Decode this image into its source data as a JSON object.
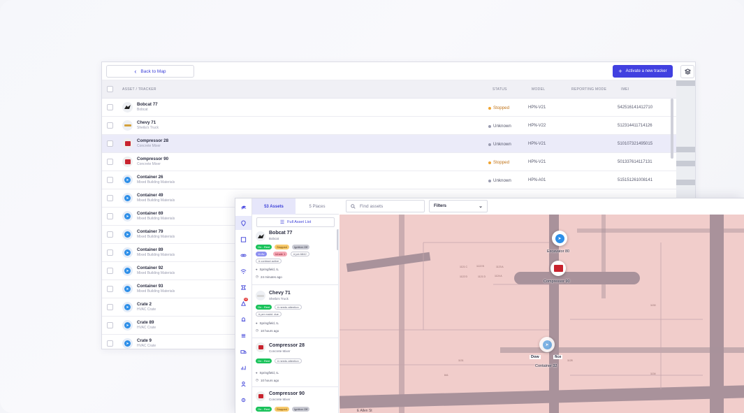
{
  "table_window": {
    "back_label": "Back to Map",
    "activate_label": "Activate a new tracker",
    "columns": {
      "asset": "ASSET / TRACKER",
      "status": "STATUS",
      "model": "MODEL",
      "reporting": "REPORTING MODE",
      "imei": "IMEI"
    },
    "rows": [
      {
        "name": "Bobcat 77",
        "sub": "Bobcat",
        "status": "Stopped",
        "model": "HPN-V21",
        "imei": "542516141412710"
      },
      {
        "name": "Chevy 71",
        "sub": "Sheila's Truck",
        "status": "Unknown",
        "model": "HPN-V22",
        "imei": "512314411714126"
      },
      {
        "name": "Compressor 28",
        "sub": "Concrete Mixer",
        "status": "Unknown",
        "model": "HPN-V21",
        "imei": "510107321495015"
      },
      {
        "name": "Compressor 90",
        "sub": "Concrete Mixer",
        "status": "Stopped",
        "model": "HPN-V21",
        "imei": "501337614117131"
      },
      {
        "name": "Container 26",
        "sub": "Mixed Building Materials",
        "status": "Unknown",
        "model": "HPN-A01",
        "imei": "515151261008141"
      },
      {
        "name": "Container 49",
        "sub": "Mixed Building Materials"
      },
      {
        "name": "Container 69",
        "sub": "Mixed Building Materials"
      },
      {
        "name": "Container 79",
        "sub": "Mixed Building Materials"
      },
      {
        "name": "Container 89",
        "sub": "Mixed Building Materials"
      },
      {
        "name": "Container 92",
        "sub": "Mixed Building Materials"
      },
      {
        "name": "Container 93",
        "sub": "Mixed Building Materials"
      },
      {
        "name": "Crate 2",
        "sub": "HVAC Crate"
      },
      {
        "name": "Crate 89",
        "sub": "HVAC Crate"
      },
      {
        "name": "Crate 9",
        "sub": "HVAC Crate"
      }
    ]
  },
  "map_window": {
    "tabs": {
      "assets": "53 Assets",
      "places": "5 Places"
    },
    "full_list_label": "Full Asset List",
    "search_placeholder": "Find assets",
    "filters_label": "Filters",
    "notification_count": "12",
    "cards": [
      {
        "name": "Bobcat 77",
        "sub": "Bobcat",
        "tags": [
          "On - Rent",
          "Stopped",
          "Ignition Off"
        ],
        "tags2": [
          "11.8v",
          "Inhale 1",
          "# job 6842"
        ],
        "tags3": [
          "# contract active"
        ],
        "location": "Springfield, IL",
        "time": "24 minutes ago"
      },
      {
        "name": "Chevy 71",
        "sub": "Sheila's Truck",
        "tags": [
          "On - Rent",
          "# needs attention"
        ],
        "tags2": [
          "# per maint. due"
        ],
        "location": "Springfield, IL",
        "time": "10 hours ago"
      },
      {
        "name": "Compressor 28",
        "sub": "Concrete Mixer",
        "tags": [
          "On - Rent",
          "# needs attention"
        ],
        "location": "Springfield, IL",
        "time": "10 hours ago"
      },
      {
        "name": "Compressor 90",
        "sub": "Concrete Mixer",
        "tags": [
          "On - Rent",
          "Stopped",
          "Ignition Off"
        ]
      }
    ],
    "map_labels": {
      "excavator": "Excavator 80",
      "compressor": "Compressor 90",
      "container": "Container 32",
      "office_left": "Dow",
      "office_right": "fice",
      "street_label": "E Allen St"
    },
    "lot_numbers": [
      "1121 C",
      "1122 B",
      "1123 A",
      "1122 D",
      "1124 A",
      "1121 D",
      "1130",
      "1131",
      "841",
      "1134",
      "1128"
    ]
  },
  "colors": {
    "accent": "#4140e0",
    "stopped": "#f0a430",
    "unknown": "#9a9cb0",
    "map_bg": "#f1cdcb",
    "road": "#a8909a"
  }
}
